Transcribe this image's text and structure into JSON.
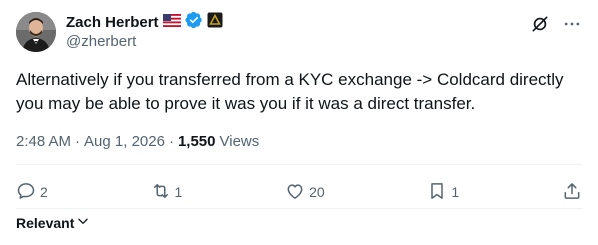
{
  "author": {
    "display_name": "Zach Herbert",
    "handle": "@zherbert"
  },
  "icons": {
    "flag": "us-flag-icon",
    "verified": "verified-badge-icon",
    "affiliation": "affiliation-badge-icon",
    "grok": "grok-icon",
    "more": "more-icon"
  },
  "tweet": {
    "text": "Alternatively if you transferred from a KYC exchange -> Coldcard directly you may be able to prove it was you if it was a direct transfer."
  },
  "meta": {
    "time": "2:48 AM",
    "separator": "·",
    "date": "Aug 1, 2026",
    "views_count": "1,550",
    "views_label": "Views"
  },
  "actions": {
    "replies": "2",
    "reposts": "1",
    "likes": "20",
    "bookmarks": "1"
  },
  "sort": {
    "label": "Relevant"
  },
  "colors": {
    "text_primary": "#0f1419",
    "text_secondary": "#536471",
    "verified_blue": "#1d9bf0",
    "divider": "#eff3f4"
  }
}
